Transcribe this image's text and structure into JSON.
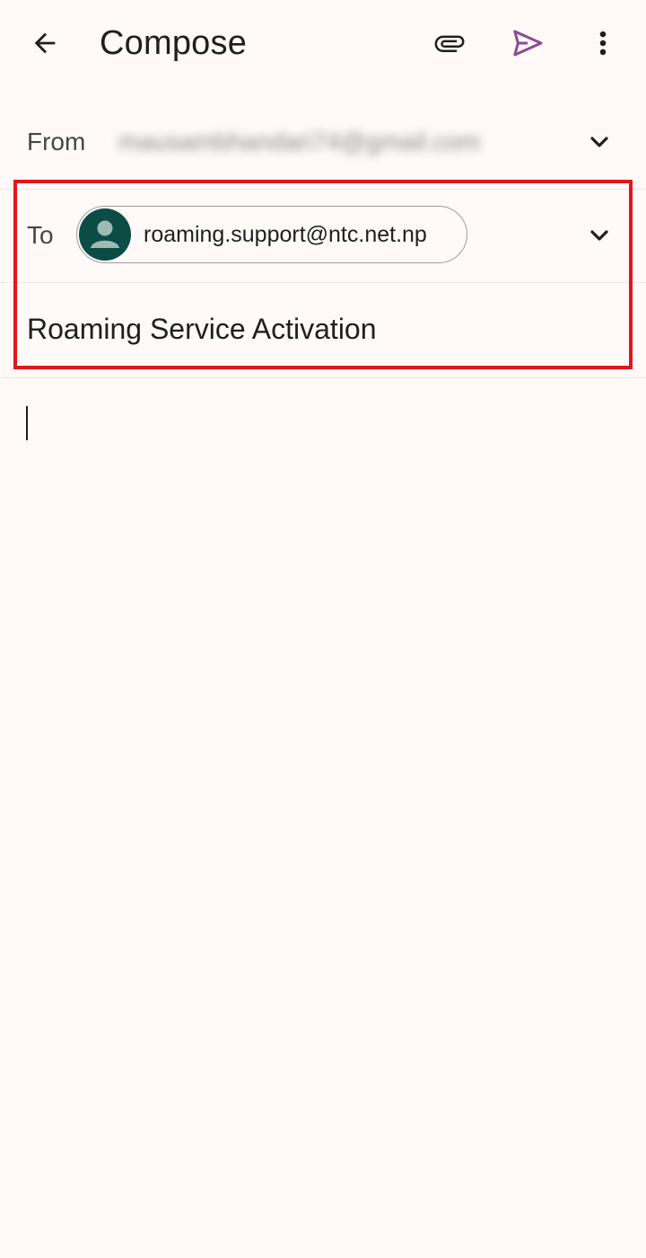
{
  "appbar": {
    "title": "Compose",
    "icons": {
      "back": "arrow-back-icon",
      "attach": "paperclip-icon",
      "send": "send-icon",
      "more": "more-vert-icon"
    },
    "send_color": "#8a4b93"
  },
  "from": {
    "label": "From",
    "value": "mausambhandari74@gmail.com"
  },
  "to": {
    "label": "To",
    "recipient": "roaming.support@ntc.net.np",
    "avatar_color": "#0b4d45"
  },
  "subject": {
    "value": "Roaming Service Activation"
  },
  "body": {
    "value": ""
  },
  "colors": {
    "background": "#fffaf8",
    "highlight": "#e8141b"
  }
}
